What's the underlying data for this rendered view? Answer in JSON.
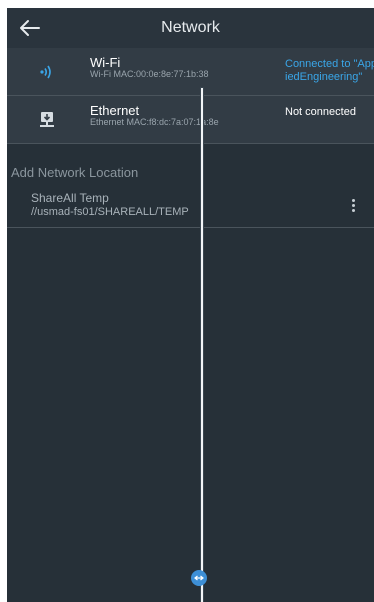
{
  "header": {
    "title": "Network",
    "back_icon": "arrow-left-icon"
  },
  "interfaces": [
    {
      "name": "Wi-Fi",
      "mac": "Wi-Fi MAC:00:0e:8e:77:1b:38",
      "status": "Connected to \"AppliedEngineering\"",
      "status_color": "#3aa6e8",
      "icon": "wifi-icon"
    },
    {
      "name": "Ethernet",
      "mac": "Ethernet MAC:f8:dc:7a:07:1a:8e",
      "status": "Not connected",
      "status_color": "#ffffff",
      "icon": "ethernet-icon"
    }
  ],
  "add_location_label": "Add Network Location",
  "locations": [
    {
      "name": "ShareAll Temp",
      "path": "//usmad-fs01/SHAREALL/TEMP",
      "menu_icon": "more-vert-icon"
    }
  ],
  "colors": {
    "background": "#263038",
    "row": "#323c45",
    "accent": "#3aa6e8"
  }
}
